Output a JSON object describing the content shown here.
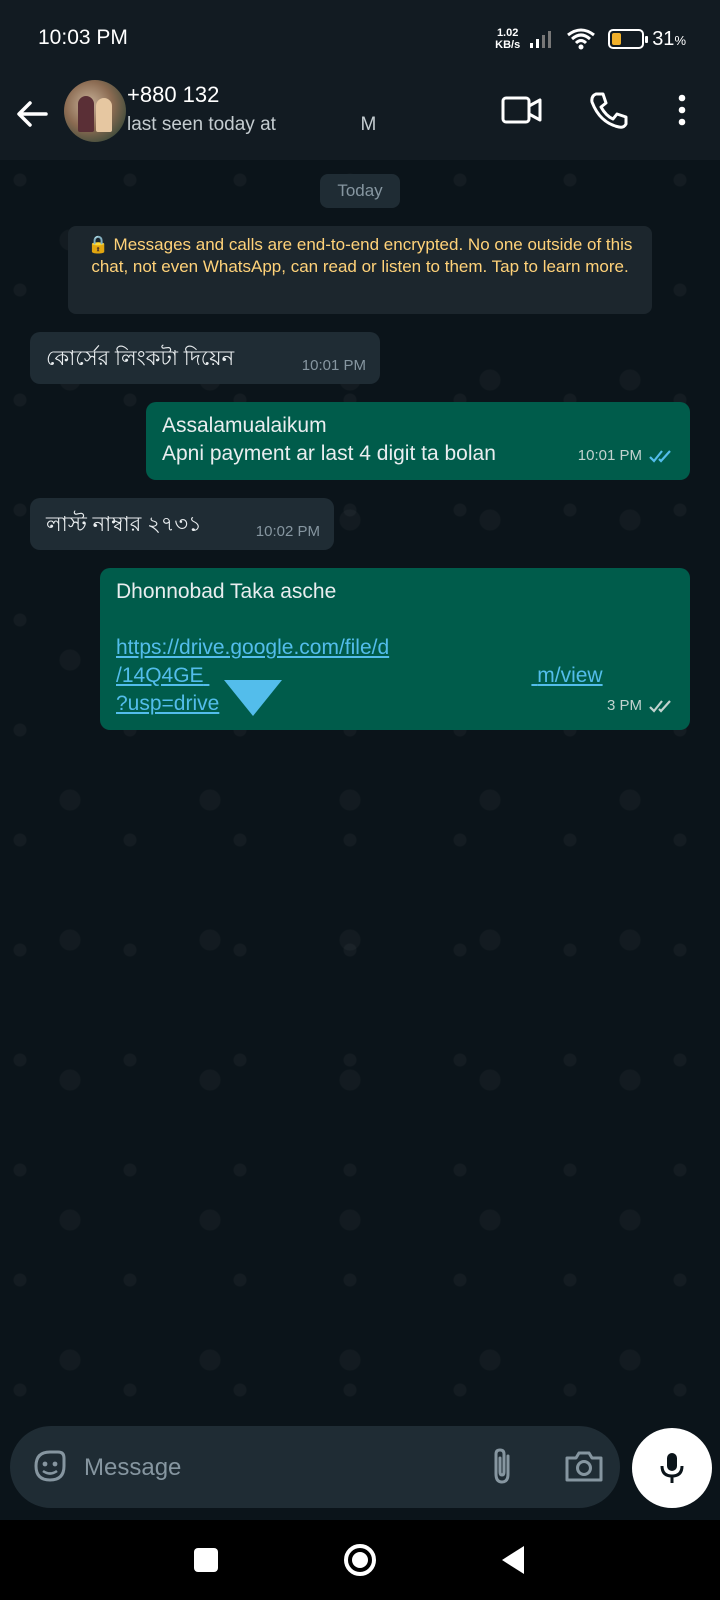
{
  "status_bar": {
    "time": "10:03 PM",
    "net_speed_value": "1.02",
    "net_speed_unit": "KB/s",
    "battery_pct": "31",
    "battery_unit": "%",
    "battery_level": 0.31
  },
  "header": {
    "contact_name": "+880 132",
    "last_seen": "last seen today at",
    "last_seen_suffix": "M",
    "icons": [
      "back-arrow-icon",
      "video-call-icon",
      "voice-call-icon",
      "more-options-icon"
    ]
  },
  "chat": {
    "date_chip": "Today",
    "encryption_notice": "Messages and calls are end-to-end encrypted. No one outside of this chat, not even WhatsApp, can read or listen to them. Tap to learn more.",
    "messages": [
      {
        "direction": "incoming",
        "text": "কোর্সের লিংকটা দিয়েন",
        "time": "10:01 PM"
      },
      {
        "direction": "outgoing",
        "line1": "Assalamualaikum",
        "line2": "Apni payment ar last 4 digit ta bolan",
        "time": "10:01 PM",
        "status": "read"
      },
      {
        "direction": "incoming",
        "text": "লাস্ট নাম্বার ২৭৩১",
        "time": "10:02 PM"
      },
      {
        "direction": "outgoing",
        "text": "Dhonnobad Taka asche",
        "link_line1": "https://drive.google.com/file/d",
        "link_line2_start": "/14Q4GE",
        "link_line2_end": "m/view",
        "link_line3": "?usp=drive",
        "time": "3 PM",
        "status": "delivered"
      }
    ]
  },
  "composer": {
    "placeholder": "Message"
  },
  "colors": {
    "background": "#0b141a",
    "outgoing_bubble": "#005c4b",
    "incoming_bubble": "#1f2c34",
    "link": "#53bdeb",
    "read_tick": "#53bdeb",
    "notice_text": "#ffd279"
  }
}
